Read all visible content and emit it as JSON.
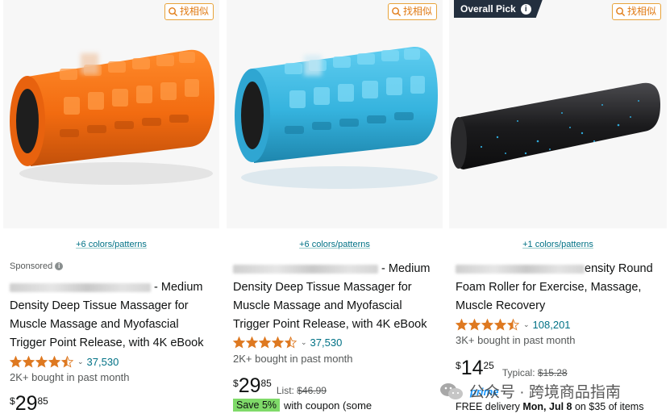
{
  "find_similar_label": "找相似",
  "cards": [
    {
      "colors_link": "+6 colors/patterns",
      "sponsored_label": "Sponsored",
      "title_visible": "- Medium Density Deep Tissue Massager for Muscle Massage and Myofascial Trigger Point Release, with 4K eBook",
      "title_line1": "- Medium",
      "title_line2": "Density Deep Tissue Massager for",
      "title_line3": "Muscle Massage and Myofascial",
      "title_line4": "Trigger Point Release, with 4K eBook",
      "rating_stars": 4.5,
      "rating_count": "37,530",
      "bought": "2K+ bought in past month",
      "price_symbol": "$",
      "price_whole": "29",
      "price_fraction": "85",
      "product_color": "#f26b10"
    },
    {
      "colors_link": "+6 colors/patterns",
      "title_line1": "- Medium",
      "title_line2": "Density Deep Tissue Massager for",
      "title_line3": "Muscle Massage and Myofascial",
      "title_line4": "Trigger Point Release, with 4K eBook",
      "rating_stars": 4.5,
      "rating_count": "37,530",
      "bought": "2K+ bought in past month",
      "price_symbol": "$",
      "price_whole": "29",
      "price_fraction": "85",
      "list_label": "List:",
      "list_price": "$46.99",
      "coupon_badge": "Save 5%",
      "coupon_text": "with coupon (some",
      "product_color": "#35b3de"
    },
    {
      "overall_pick": "Overall Pick",
      "colors_link": "+1 colors/patterns",
      "title_line1": "ensity Round",
      "title_line2": "Foam Roller for Exercise, Massage,",
      "title_line3": "Muscle Recovery",
      "rating_stars": 4.5,
      "rating_count": "108,201",
      "bought": "3K+ bought in past month",
      "price_symbol": "$",
      "price_whole": "14",
      "price_fraction": "25",
      "typical_label": "Typical:",
      "typical_price": "$15.28",
      "prime": "prime",
      "delivery_prefix": "FREE delivery",
      "delivery_date": "Mon, Jul 8",
      "delivery_suffix": "on $35 of items",
      "product_color": "#1b1b1d"
    }
  ],
  "watermark": "公众号 · 跨境商品指南",
  "colors": {
    "link": "#007185",
    "star": "#de7921",
    "find_similar": "#e07b15",
    "coupon_badge": "#7fda69",
    "overall_pick_bg": "#232f3e"
  }
}
